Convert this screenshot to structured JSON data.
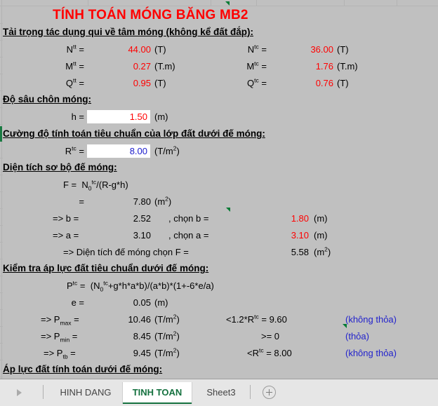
{
  "title": "TÍNH TOÁN MÓNG BĂNG  MB2",
  "sections": {
    "loads_header": "Tải trọng tác dụng qui về tâm móng (không kể đất đắp):",
    "depth_header": "Độ sâu chôn móng:",
    "strength_header": "Cường độ tính toán tiêu chuẩn của lớp đất dưới đế móng:",
    "area_header": "Diện tích sơ bộ đế móng:",
    "check_header": "Kiểm tra áp lực đất tiêu chuẩn dưới đế móng:",
    "design_pressure_header": "Áp lực đất tính toán dưới đế móng:"
  },
  "loads": {
    "left": [
      {
        "symbol": "N",
        "sup": "tt",
        "eq": "=",
        "value": "44.00",
        "unit": "(T)"
      },
      {
        "symbol": "M",
        "sup": "tt",
        "eq": "=",
        "value": "0.27",
        "unit": "(T.m)"
      },
      {
        "symbol": "Q",
        "sup": "tt",
        "eq": "=",
        "value": "0.95",
        "unit": "(T)"
      }
    ],
    "right": [
      {
        "symbol": "N",
        "sup": "tc",
        "eq": "=",
        "value": "36.00",
        "unit": "(T)"
      },
      {
        "symbol": "M",
        "sup": "tc",
        "eq": "=",
        "value": "1.76",
        "unit": "(T.m)"
      },
      {
        "symbol": "Q",
        "sup": "tc",
        "eq": "=",
        "value": "0.76",
        "unit": "(T)"
      }
    ]
  },
  "depth": {
    "label": "h =",
    "value": "1.50",
    "unit": "(m)"
  },
  "strength": {
    "label": "R",
    "sup": "tc",
    "eq": "=",
    "value": "8.00",
    "unit_pre": "(T/m",
    "unit_sup": "2",
    "unit_post": ")"
  },
  "area": {
    "formula_lhs": "F =",
    "formula_n": "N",
    "formula_sub": "0",
    "formula_sup": "tc",
    "formula_rest": "/(R-g*h)",
    "eq_label": "=",
    "F_value": "7.80",
    "F_unit_pre": "(m",
    "F_unit_sup": "2",
    "F_unit_post": ")",
    "b_label": "=> b =",
    "b_calc": "2.52",
    "b_chon_label": ", chọn b =",
    "b_chon": "1.80",
    "b_unit": "(m)",
    "a_label": "=> a =",
    "a_calc": "3.10",
    "a_chon_label": ", chọn a =",
    "a_chon": "3.10",
    "a_unit": "(m)",
    "final_label": "=> Diện tích đế móng chọn F =",
    "final_value": "5.58",
    "final_unit_pre": "(m",
    "final_unit_sup": "2",
    "final_unit_post": ")"
  },
  "check": {
    "formula_p": "P",
    "formula_p_sup": "tc",
    "formula_eq": "=",
    "formula_n": "(N",
    "formula_n_sub": "0",
    "formula_n_sup": "tc",
    "formula_rest": "+g*h*a*b)/(a*b)*(1+-6*e/a)",
    "e_label": "e =",
    "e_value": "0.05",
    "e_unit": "(m)",
    "rows": [
      {
        "label_pre": "=> P",
        "label_sub": "max",
        "label_post": " =",
        "value": "10.46",
        "unit_pre": "(T/m",
        "unit_sup": "2",
        "unit_post": ")",
        "cond_pre": "<1.2*R",
        "cond_sup": "tc",
        "cond_post": " = 9.60",
        "result": "(không thỏa)"
      },
      {
        "label_pre": "=> P",
        "label_sub": "min",
        "label_post": " =",
        "value": "8.45",
        "unit_pre": "(T/m",
        "unit_sup": "2",
        "unit_post": ")",
        "cond_pre": ">= 0",
        "cond_sup": "",
        "cond_post": "",
        "result": "(thỏa)"
      },
      {
        "label_pre": "=> P",
        "label_sub": "tb",
        "label_post": " =",
        "value": "9.45",
        "unit_pre": "(T/m",
        "unit_sup": "2",
        "unit_post": ")",
        "cond_pre": "<R",
        "cond_sup": "tc",
        "cond_post": " = 8.00",
        "result": "(không thỏa)"
      }
    ]
  },
  "sheet_tabs": {
    "tabs": [
      {
        "name": "HINH DANG",
        "active": false
      },
      {
        "name": "TINH TOAN",
        "active": true
      },
      {
        "name": "Sheet3",
        "active": false
      }
    ],
    "add_sheet_label": "+"
  },
  "colors": {
    "grid_bg": "#c0c0c0",
    "title_red": "#ff0000",
    "value_red": "#ff0000",
    "value_blue": "#2222cc",
    "active_tab_green": "#15713f",
    "comment_marker_green": "#007a33"
  }
}
